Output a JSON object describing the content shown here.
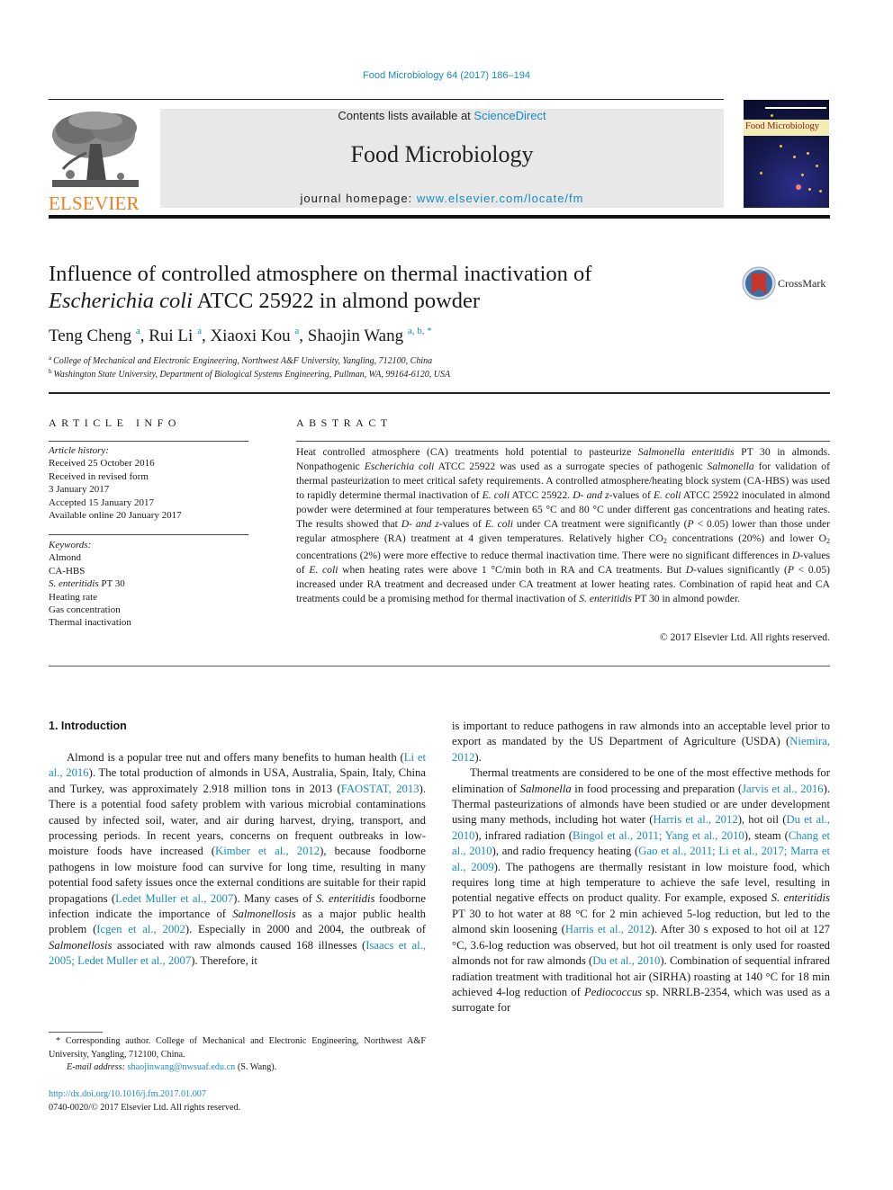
{
  "header": {
    "journal_reference": "Food Microbiology 64 (2017) 186–194",
    "contents_prefix": "Contents lists available at ",
    "contents_link": "ScienceDirect",
    "journal_title": "Food Microbiology",
    "homepage_prefix": "journal homepage: ",
    "homepage_link": "www.elsevier.com/locate/fm",
    "publisher_logo_text": "ELSEVIER",
    "cover_title": "Food Microbiology",
    "crossmark_label": "CrossMark",
    "colors": {
      "link": "#1a8ac0",
      "publisher": "#f07e1b",
      "header_box": "#e8e8e8"
    }
  },
  "article": {
    "title_line1": "Influence of controlled atmosphere on thermal inactivation of",
    "title_italic": "Escherichia coli",
    "title_rest": " ATCC 25922 in almond powder",
    "authors": [
      {
        "name": "Teng Cheng",
        "sup": "a"
      },
      {
        "name": "Rui Li",
        "sup": "a"
      },
      {
        "name": "Xiaoxi Kou",
        "sup": "a"
      },
      {
        "name": "Shaojin Wang",
        "sup": "a, b, *"
      }
    ],
    "affiliations": [
      {
        "key": "a",
        "text": "College of Mechanical and Electronic Engineering, Northwest A&F University, Yangling, 712100, China"
      },
      {
        "key": "b",
        "text": "Washington State University, Department of Biological Systems Engineering, Pullman, WA, 99164-6120, USA"
      }
    ]
  },
  "article_info": {
    "heading": "ARTICLE INFO",
    "history_label": "Article history:",
    "history": [
      "Received 25 October 2016",
      "Received in revised form",
      "3 January 2017",
      "Accepted 15 January 2017",
      "Available online 20 January 2017"
    ],
    "keywords_label": "Keywords:",
    "keywords": [
      "Almond",
      "CA-HBS",
      "S. enteritidis",
      "Heating rate",
      "Gas concentration",
      "Thermal inactivation"
    ],
    "keyword_3_suffix": " PT 30"
  },
  "abstract": {
    "heading": "ABSTRACT",
    "p": [
      "Heat controlled atmosphere (CA) treatments hold potential to pasteurize ",
      "Salmonella enteritidis",
      " PT 30 in almonds. Nonpathogenic ",
      "Escherichia coli",
      " ATCC 25922 was used as a surrogate species of pathogenic ",
      "Salmonella",
      " for validation of thermal pasteurization to meet critical safety requirements. A controlled atmosphere/heating block system (CA-HBS) was used to rapidly determine thermal inactivation of ",
      "E. coli",
      " ATCC 25922. ",
      "D- and z",
      "-values of ",
      "E. coli",
      " ATCC 25922 inoculated in almond powder were determined at four temperatures between 65 °C and 80 °C under different gas concentrations and heating rates. The results showed that ",
      "D- and z",
      "-values of ",
      "E. coli",
      " under CA treatment were significantly (",
      "P",
      " < 0.05) lower than those under regular atmosphere (RA) treatment at 4 given temperatures. Relatively higher CO",
      "2",
      " concentrations (20%) and lower O",
      "2",
      " concentrations (2%) were more effective to reduce thermal inactivation time. There were no significant differences in ",
      "D",
      "-values of ",
      "E. coli",
      " when heating rates were above 1 °C/min both in RA and CA treatments. But ",
      "D",
      "-values significantly (",
      "P",
      " < 0.05) increased under RA treatment and decreased under CA treatment at lower heating rates. Combination of rapid heat and CA treatments could be a promising method for thermal inactivation of ",
      "S. enteritidis",
      " PT 30 in almond powder."
    ],
    "copyright": "© 2017 Elsevier Ltd. All rights reserved."
  },
  "body": {
    "section_heading": "1.  Introduction",
    "left": [
      "Almond is a popular tree nut and offers many benefits to human health (",
      "Li et al., 2016",
      "). The total production of almonds in USA, Australia, Spain, Italy, China and Turkey, was approximately 2.918 million tons in 2013 (",
      "FAOSTAT, 2013",
      "). There is a potential food safety problem with various microbial contaminations caused by infected soil, water, and air during harvest, drying, transport, and processing periods. In recent years, concerns on frequent outbreaks in low-moisture foods have increased (",
      "Kimber et al., 2012",
      "), because foodborne pathogens in low moisture food can survive for long time, resulting in many potential food safety issues once the external conditions are suitable for their rapid propagations (",
      "Ledet Muller et al., 2007",
      "). Many cases of ",
      "S. enteritidis",
      " foodborne infection indicate the importance of ",
      "Salmonellosis",
      " as a major public health problem (",
      "Icgen et al., 2002",
      "). Especially in 2000 and 2004, the outbreak of ",
      "Salmonellosis",
      " associated with raw almonds caused 168 illnesses (",
      "Isaacs et al., 2005; Ledet Muller et al., 2007",
      "). Therefore, it"
    ],
    "right_p1": [
      "is important to reduce pathogens in raw almonds into an acceptable level prior to export as mandated by the US Department of Agriculture (USDA) (",
      "Niemira, 2012",
      ")."
    ],
    "right_p2": [
      "Thermal treatments are considered to be one of the most effective methods for elimination of ",
      "Salmonella",
      " in food processing and preparation (",
      "Jarvis et al., 2016",
      "). Thermal pasteurizations of almonds have been studied or are under development using many methods, including hot water (",
      "Harris et al., 2012",
      "), hot oil (",
      "Du et al., 2010",
      "), infrared radiation (",
      "Bingol et al., 2011; Yang et al., 2010",
      "), steam (",
      "Chang et al., 2010",
      "), and radio frequency heating (",
      "Gao et al., 2011; Li et al., 2017; Marra et al., 2009",
      "). The pathogens are thermally resistant in low moisture food, which requires long time at high temperature to achieve the safe level, resulting in potential negative effects on product quality. For example, exposed ",
      "S. enteritidis",
      " PT 30 to hot water at 88 °C for 2 min achieved 5-log reduction, but led to the almond skin loosening (",
      "Harris et al., 2012",
      "). After 30 s exposed to hot oil at 127 °C, 3.6-log reduction was observed, but hot oil treatment is only used for roasted almonds not for raw almonds (",
      "Du et al., 2010",
      "). Combination of sequential infrared radiation treatment with traditional hot air (SIRHA) roasting at 140 °C for 18 min achieved 4-log reduction of ",
      "Pediococcus",
      " sp. NRRLB-2354, which was used as a surrogate for"
    ]
  },
  "footnotes": {
    "corresponding": "* Corresponding author. College of Mechanical and Electronic Engineering, Northwest A&F University, Yangling, 712100, China.",
    "email_label": "E-mail address: ",
    "email": "shaojinwang@nwsuaf.edu.cn",
    "email_suffix": " (S. Wang).",
    "doi": "http://dx.doi.org/10.1016/j.fm.2017.01.007",
    "issn": "0740-0020/© 2017 Elsevier Ltd. All rights reserved."
  }
}
